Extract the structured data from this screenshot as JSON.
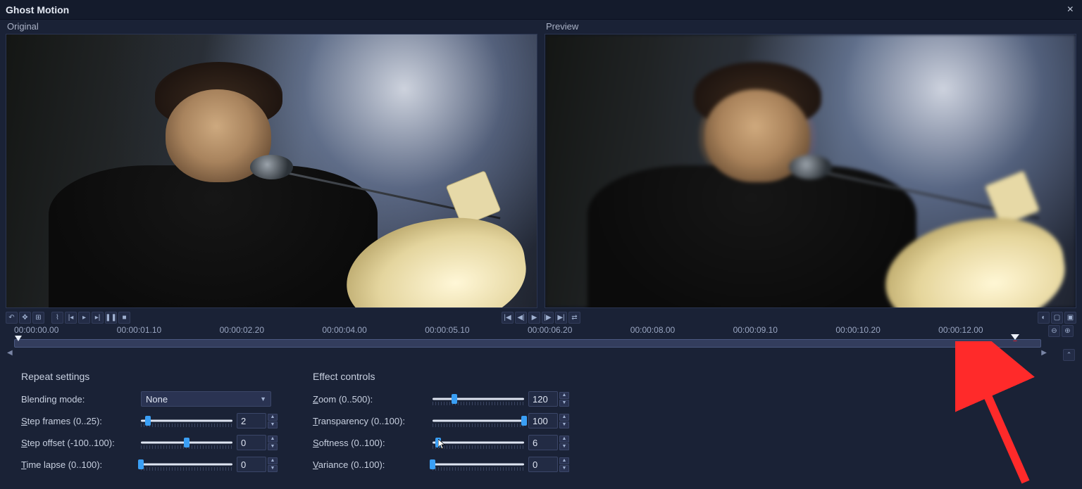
{
  "window": {
    "title": "Ghost Motion",
    "close_glyph": "×"
  },
  "panes": {
    "original": "Original",
    "preview": "Preview"
  },
  "timeline": {
    "ticks": [
      "00:00:00.00",
      "00:00:01.10",
      "00:00:02.20",
      "00:00:04.00",
      "00:00:05.10",
      "00:00:06.20",
      "00:00:08.00",
      "00:00:09.10",
      "00:00:10.20",
      "00:00:12.00"
    ]
  },
  "repeat": {
    "heading": "Repeat settings",
    "blending_label": "Blending mode:",
    "blending_value": "None",
    "step_frames_label_pre": "S",
    "step_frames_label": "tep frames (0..25):",
    "step_frames_value": "2",
    "step_offset_label_pre": "S",
    "step_offset_label": "tep offset (-100..100):",
    "step_offset_value": "0",
    "time_lapse_label_pre": "T",
    "time_lapse_label": "ime lapse (0..100):",
    "time_lapse_value": "0"
  },
  "effect": {
    "heading": "Effect controls",
    "zoom_label_pre": "Z",
    "zoom_label": "oom (0..500):",
    "zoom_value": "120",
    "transparency_label_pre": "T",
    "transparency_label": "ransparency (0..100):",
    "transparency_value": "100",
    "softness_label_pre": "S",
    "softness_label": "oftness (0..100):",
    "softness_value": "6",
    "variance_label_pre": "V",
    "variance_label": "ariance (0..100):",
    "variance_value": "0"
  },
  "percents": {
    "step_frames": 8,
    "step_offset": 50,
    "time_lapse": 0,
    "zoom": 24,
    "transparency": 100,
    "softness": 6,
    "variance": 0
  },
  "glyphs": {
    "undo": "↶",
    "move": "✥",
    "crop": "⊞",
    "zigzag": "⌇",
    "prevkey": "|◂",
    "nextkey": "▸|",
    "play_s": "▸",
    "pause_s": "❚❚",
    "stop_s": "■",
    "first": "|◀",
    "stepback": "◀|",
    "play": "▶",
    "stepfwd": "|▶",
    "last": "▶|",
    "loop": "⇄",
    "gauge": "◐",
    "screen1": "▢",
    "screen2": "▣",
    "zoomout": "⊖",
    "zoomin": "⊕",
    "left": "◀",
    "right": "▶",
    "up": "⌃"
  }
}
